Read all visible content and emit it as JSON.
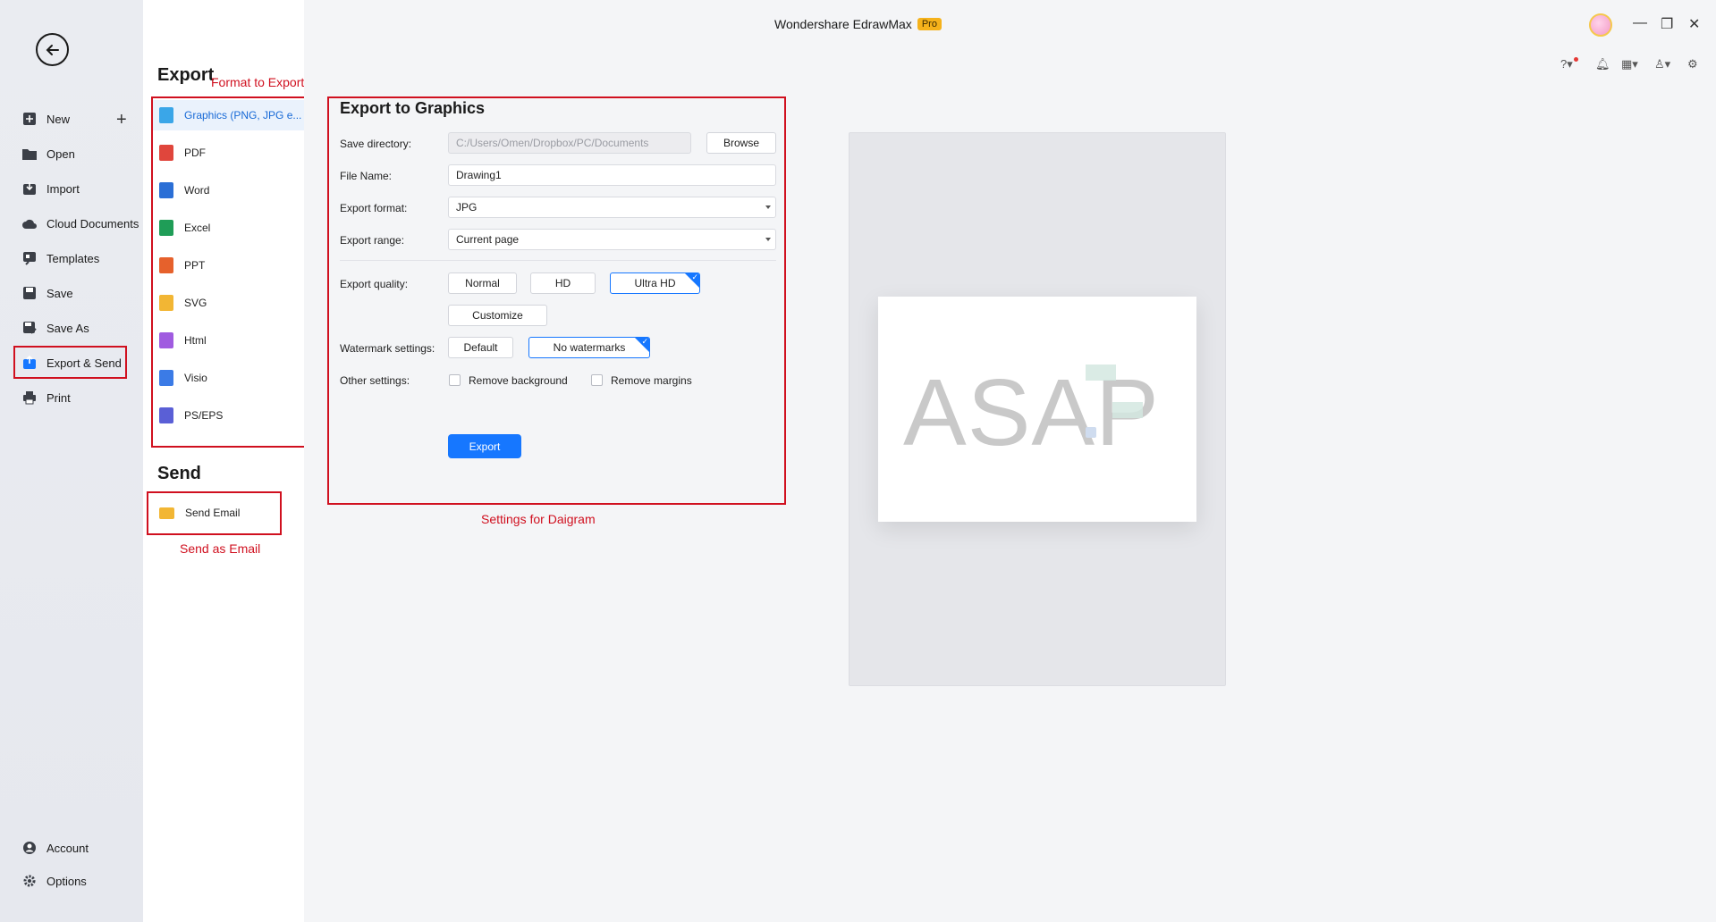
{
  "window": {
    "app_title": "Wondershare EdrawMax",
    "badge": "Pro"
  },
  "rail": {
    "items": [
      {
        "label": "New"
      },
      {
        "label": "Open"
      },
      {
        "label": "Import"
      },
      {
        "label": "Cloud Documents"
      },
      {
        "label": "Templates"
      },
      {
        "label": "Save"
      },
      {
        "label": "Save As"
      },
      {
        "label": "Export & Send"
      },
      {
        "label": "Print"
      }
    ],
    "bottom": [
      {
        "label": "Account"
      },
      {
        "label": "Options"
      }
    ]
  },
  "export_section": {
    "title": "Export",
    "formats": [
      {
        "label": "Graphics (PNG, JPG e...",
        "color": "#3aa6e8"
      },
      {
        "label": "PDF",
        "color": "#e0463c"
      },
      {
        "label": "Word",
        "color": "#2b6fd6"
      },
      {
        "label": "Excel",
        "color": "#1f9d57"
      },
      {
        "label": "PPT",
        "color": "#e6612c"
      },
      {
        "label": "SVG",
        "color": "#f2b634"
      },
      {
        "label": "Html",
        "color": "#a05be0"
      },
      {
        "label": "Visio",
        "color": "#3b7be6"
      },
      {
        "label": "PS/EPS",
        "color": "#5a5fd6"
      }
    ]
  },
  "send_section": {
    "title": "Send",
    "items": [
      {
        "label": "Send Email"
      }
    ]
  },
  "annotations": {
    "format": "Format to Export in",
    "send": "Send as Email",
    "settings": "Settings for Daigram"
  },
  "settings": {
    "title": "Export to Graphics",
    "save_directory_label": "Save directory:",
    "save_directory_value": "C:/Users/Omen/Dropbox/PC/Documents",
    "browse_label": "Browse",
    "file_name_label": "File Name:",
    "file_name_value": "Drawing1",
    "export_format_label": "Export format:",
    "export_format_value": "JPG",
    "export_range_label": "Export range:",
    "export_range_value": "Current page",
    "quality_label": "Export quality:",
    "quality_options": [
      "Normal",
      "HD",
      "Ultra HD"
    ],
    "quality_selected": "Ultra HD",
    "customize_label": "Customize",
    "watermark_label": "Watermark settings:",
    "watermark_options": [
      "Default",
      "No watermarks"
    ],
    "watermark_selected": "No watermarks",
    "other_label": "Other settings:",
    "remove_background_label": "Remove background",
    "remove_margins_label": "Remove margins",
    "export_button": "Export"
  },
  "preview": {
    "text": "ASAP"
  },
  "colors": {
    "accent": "#1677ff",
    "annotation": "#d0101f",
    "pro_badge": "#f5b21b"
  }
}
